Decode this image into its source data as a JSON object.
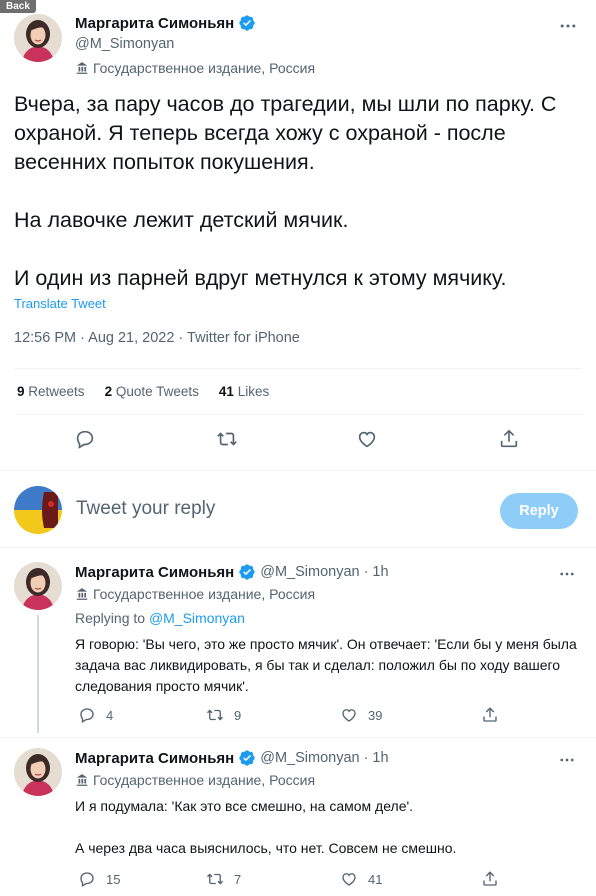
{
  "topbar": {
    "back_label": "Back"
  },
  "main_tweet": {
    "author_name": "Маргарита Симоньян",
    "handle": "@M_Simonyan",
    "state_label": "Государственное издание, Россия",
    "paragraphs": [
      "Вчера, за пару часов до трагедии, мы шли по парку. С охраной. Я теперь всегда хожу с охраной - после весенних попыток покушения.",
      "На лавочке лежит детский мячик.",
      "И один из парней вдруг метнулся к этому мячику."
    ],
    "translate_label": "Translate Tweet",
    "meta": "12:56 PM · Aug 21, 2022 · Twitter for iPhone",
    "stats": {
      "retweets_count": "9",
      "retweets_label": "Retweets",
      "quotes_count": "2",
      "quotes_label": "Quote Tweets",
      "likes_count": "41",
      "likes_label": "Likes"
    },
    "action_icons": [
      "reply-icon",
      "retweet-icon",
      "like-icon",
      "share-icon"
    ]
  },
  "composer": {
    "placeholder": "Tweet your reply",
    "reply_button": "Reply"
  },
  "replies": [
    {
      "author_name": "Маргарита Симоньян",
      "handle": "@M_Simonyan",
      "time": "· 1h",
      "state_label": "Государственное издание, Россия",
      "replying_prefix": "Replying to",
      "replying_to": "@M_Simonyan",
      "paragraphs": [
        "Я говорю: 'Вы чего, это же просто мячик'. Он отвечает: 'Если бы у меня была задача вас ликвидировать, я бы так и сделал: положил бы по ходу вашего следования просто мячик'."
      ],
      "replies_count": "4",
      "retweets_count": "9",
      "likes_count": "39"
    },
    {
      "author_name": "Маргарита Симоньян",
      "handle": "@M_Simonyan",
      "time": "· 1h",
      "state_label": "Государственное издание, Россия",
      "paragraphs": [
        "И я подумала: 'Как это все смешно, на самом деле'.",
        "А через два часа выяснилось, что нет. Совсем не смешно."
      ],
      "replies_count": "15",
      "retweets_count": "7",
      "likes_count": "41"
    }
  ],
  "colors": {
    "accent": "#1d9bf0",
    "secondary_text": "#536471",
    "reply_button_disabled": "#8ecdf8"
  }
}
